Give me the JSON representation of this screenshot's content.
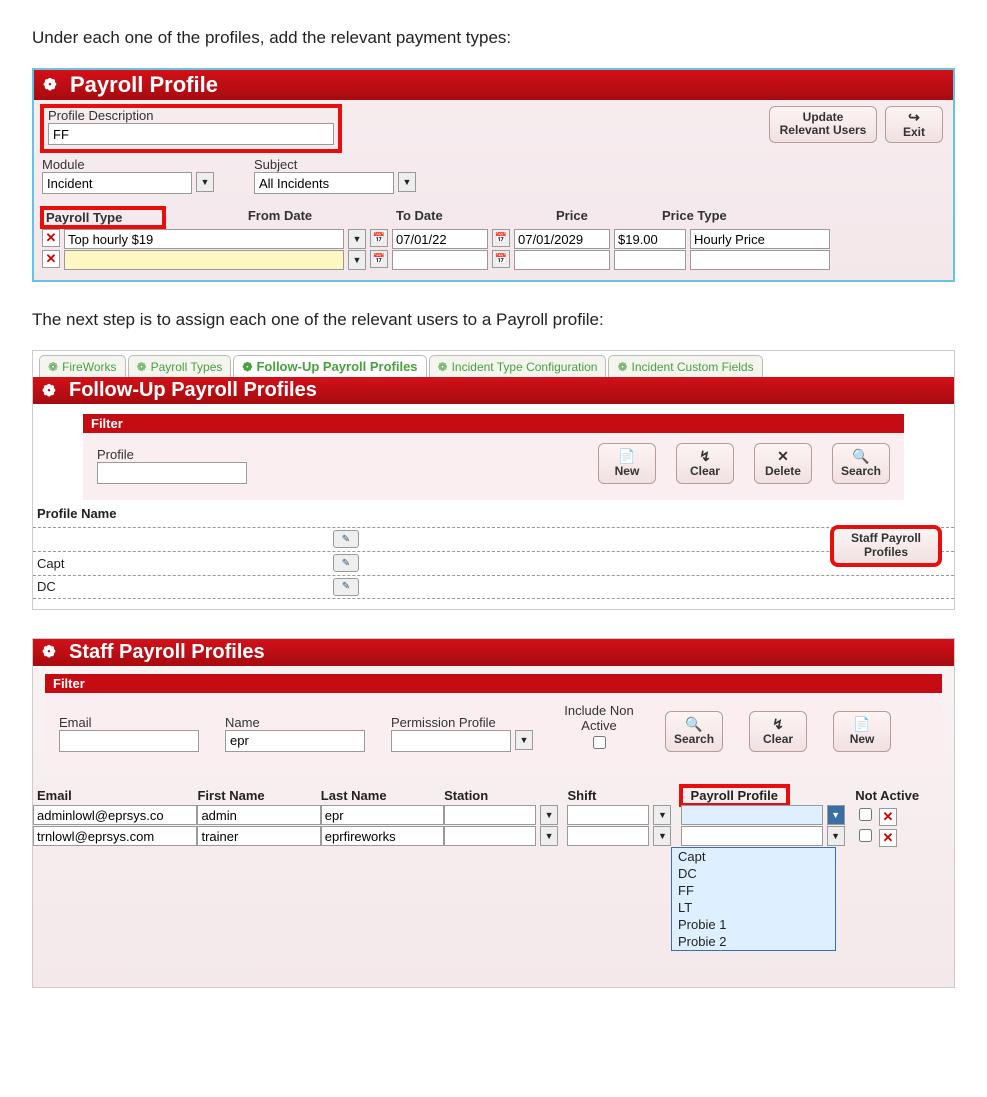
{
  "instructions": {
    "line1": "Under each one of the profiles, add the relevant payment types:",
    "line2": "The next step is to assign each one of the relevant users to a Payroll profile:"
  },
  "profile_editor": {
    "title": "Payroll Profile",
    "labels": {
      "profile_description": "Profile Description",
      "module": "Module",
      "subject": "Subject"
    },
    "values": {
      "profile_description": "FF",
      "module": "Incident",
      "subject": "All Incidents"
    },
    "buttons": {
      "update_users": "Update\nRelevant Users",
      "exit": "Exit"
    },
    "grid": {
      "headers": {
        "type": "Payroll Type",
        "from": "From Date",
        "to": "To Date",
        "price": "Price",
        "price_type": "Price Type"
      },
      "rows": [
        {
          "type": "Top hourly $19",
          "from": "07/01/22",
          "to": "07/01/2029",
          "price": "$19.00",
          "price_type": "Hourly Price"
        },
        {
          "type": "",
          "from": "",
          "to": "",
          "price": "",
          "price_type": ""
        }
      ]
    }
  },
  "tabs": {
    "items": [
      "FireWorks",
      "Payroll Types",
      "Follow-Up Payroll Profiles",
      "Incident Type Configuration",
      "Incident Custom Fields"
    ],
    "selected_index": 2
  },
  "followup": {
    "title": "Follow-Up Payroll Profiles",
    "filter_label": "Filter",
    "profile_label": "Profile",
    "profile_value": "",
    "buttons": {
      "new": "New",
      "clear": "Clear",
      "delete": "Delete",
      "search": "Search",
      "staff_profiles": "Staff Payroll\nProfiles"
    },
    "list_header": "Profile Name",
    "rows": [
      "",
      "Capt",
      "DC"
    ]
  },
  "staff": {
    "title": "Staff Payroll Profiles",
    "filter_label": "Filter",
    "labels": {
      "email": "Email",
      "name": "Name",
      "permission": "Permission Profile",
      "include_non_active": "Include Non Active"
    },
    "filter_values": {
      "email": "",
      "name": "epr",
      "permission": ""
    },
    "buttons": {
      "search": "Search",
      "clear": "Clear",
      "new": "New"
    },
    "grid": {
      "headers": {
        "email": "Email",
        "first": "First Name",
        "last": "Last Name",
        "station": "Station",
        "shift": "Shift",
        "payroll_profile": "Payroll Profile",
        "not_active": "Not Active"
      },
      "rows": [
        {
          "email": "adminlowl@eprsys.co",
          "first": "admin",
          "last": "epr",
          "station": "",
          "shift": "",
          "profile": "",
          "not_active": false
        },
        {
          "email": "trnlowl@eprsys.com",
          "first": "trainer",
          "last": "eprfireworks",
          "station": "",
          "shift": "",
          "profile": "",
          "not_active": false
        }
      ],
      "dropdown_options": [
        "Capt",
        "DC",
        "FF",
        "LT",
        "Probie 1",
        "Probie 2"
      ]
    }
  },
  "icons": {
    "gear": "❁",
    "exit": "↪",
    "pencil": "✎",
    "search": "🔍",
    "clear": "↯",
    "new": "📄",
    "delete": "✕"
  }
}
